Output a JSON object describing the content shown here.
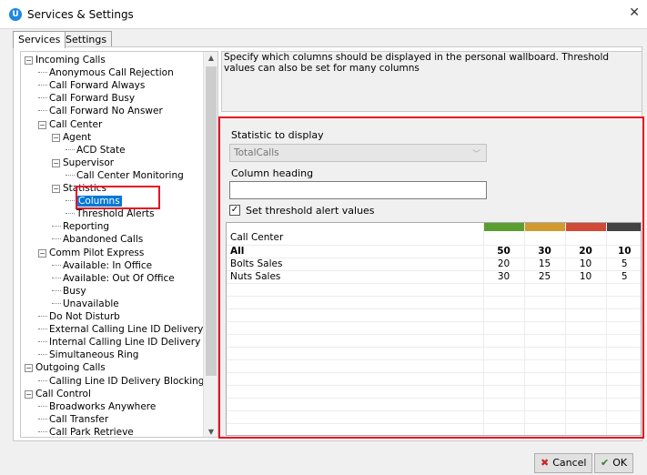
{
  "window": {
    "title": "Services & Settings"
  },
  "tabs": [
    {
      "label": "Services"
    },
    {
      "label": "Settings"
    }
  ],
  "tree": [
    {
      "label": "Incoming Calls",
      "depth": 0,
      "expander": "−"
    },
    {
      "label": "Anonymous Call Rejection",
      "depth": 1
    },
    {
      "label": "Call Forward Always",
      "depth": 1
    },
    {
      "label": "Call Forward Busy",
      "depth": 1
    },
    {
      "label": "Call Forward No Answer",
      "depth": 1
    },
    {
      "label": "Call Center",
      "depth": 1,
      "expander": "−"
    },
    {
      "label": "Agent",
      "depth": 2,
      "expander": "−"
    },
    {
      "label": "ACD State",
      "depth": 3
    },
    {
      "label": "Supervisor",
      "depth": 2,
      "expander": "−"
    },
    {
      "label": "Call Center Monitoring",
      "depth": 3
    },
    {
      "label": "Statistics",
      "depth": 2,
      "expander": "−"
    },
    {
      "label": "Columns",
      "depth": 3,
      "selected": true
    },
    {
      "label": "Threshold Alerts",
      "depth": 3
    },
    {
      "label": "Reporting",
      "depth": 2
    },
    {
      "label": "Abandoned Calls",
      "depth": 2
    },
    {
      "label": "Comm Pilot Express",
      "depth": 1,
      "expander": "−"
    },
    {
      "label": "Available: In Office",
      "depth": 2
    },
    {
      "label": "Available: Out Of Office",
      "depth": 2
    },
    {
      "label": "Busy",
      "depth": 2
    },
    {
      "label": "Unavailable",
      "depth": 2
    },
    {
      "label": "Do Not Disturb",
      "depth": 1
    },
    {
      "label": "External Calling Line ID Delivery",
      "depth": 1
    },
    {
      "label": "Internal Calling Line ID Delivery",
      "depth": 1
    },
    {
      "label": "Simultaneous Ring",
      "depth": 1
    },
    {
      "label": "Outgoing Calls",
      "depth": 0,
      "expander": "−"
    },
    {
      "label": "Calling Line ID Delivery Blocking",
      "depth": 1
    },
    {
      "label": "Call Control",
      "depth": 0,
      "expander": "−"
    },
    {
      "label": "Broadworks Anywhere",
      "depth": 1
    },
    {
      "label": "Call Transfer",
      "depth": 1
    },
    {
      "label": "Call Park Retrieve",
      "depth": 1
    }
  ],
  "description": "Specify which columns should be displayed in the personal wallboard.  Threshold values can also be set for many columns",
  "form": {
    "statistic_label": "Statistic to display",
    "statistic_value": "TotalCalls",
    "heading_label": "Column heading",
    "heading_value": "",
    "threshold_label": "Set threshold alert values",
    "threshold_checked": true
  },
  "grid": {
    "header": "Call Center",
    "threshold_colors": [
      "#5a9e2f",
      "#d09a2e",
      "#cf4a37",
      "#444444"
    ],
    "rows": [
      {
        "name": "All",
        "values": [
          "50",
          "30",
          "20",
          "10"
        ],
        "bold": true
      },
      {
        "name": "Bolts Sales",
        "values": [
          "20",
          "15",
          "10",
          "5"
        ]
      },
      {
        "name": "Nuts Sales",
        "values": [
          "30",
          "25",
          "10",
          "5"
        ]
      }
    ]
  },
  "buttons": {
    "cancel": "Cancel",
    "ok": "OK"
  }
}
